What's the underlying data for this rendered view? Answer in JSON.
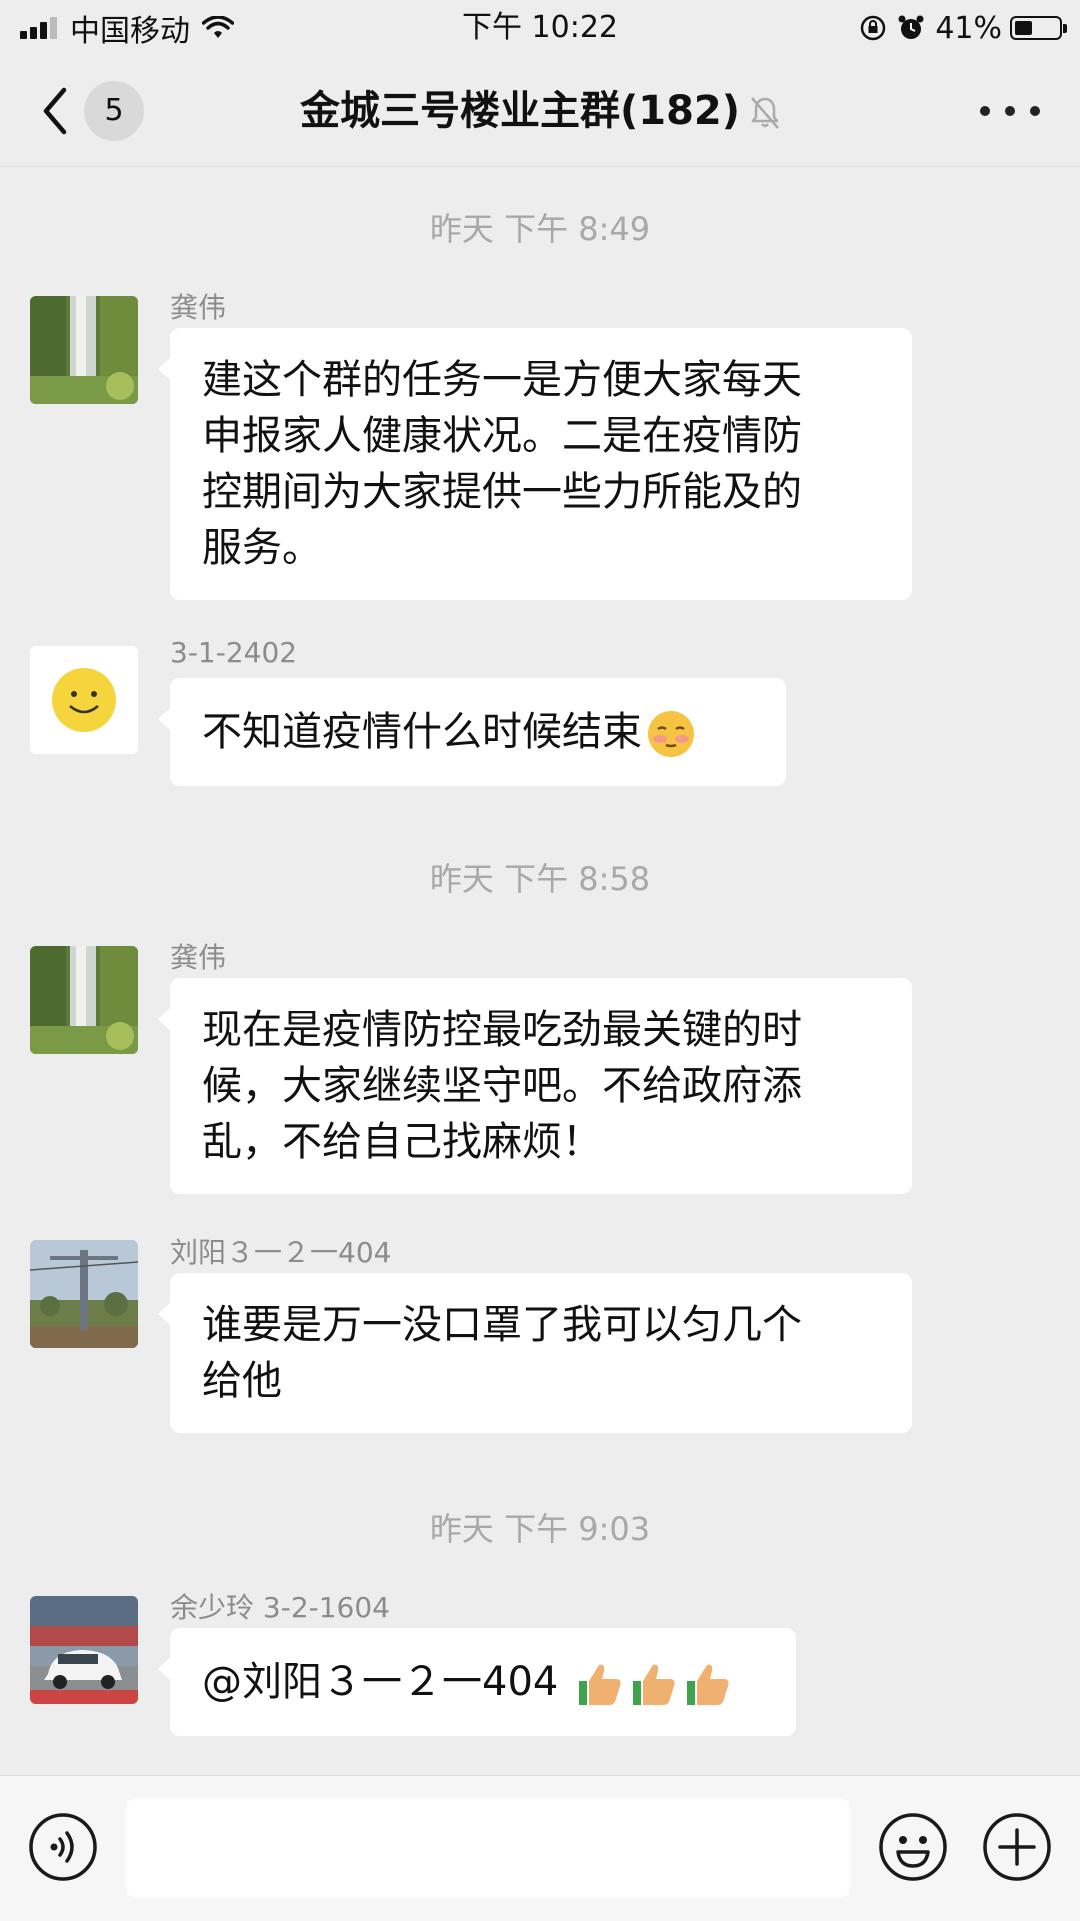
{
  "status_bar": {
    "carrier": "中国移动",
    "time": "下午 10:22",
    "battery": "41%",
    "battery_level": 0.41
  },
  "header": {
    "unread_count": "5",
    "title": "金城三号楼业主群(182)"
  },
  "messages": [
    {
      "type": "timestamp",
      "text": "昨天 下午 8:49"
    },
    {
      "type": "message",
      "sender": "龚伟",
      "avatar": "waterfall-photo",
      "lines": [
        "建这个群的任务一是方便大家每天",
        "申报家人健康状况。二是在疫情防",
        "控期间为大家提供一些力所能及的",
        "服务。"
      ]
    },
    {
      "type": "message",
      "sender": "3-1-2402",
      "avatar": "smiley-face",
      "text": "不知道疫情什么时候结束",
      "emoji": "flushed-face"
    },
    {
      "type": "timestamp",
      "text": "昨天 下午 8:58"
    },
    {
      "type": "message",
      "sender": "龚伟",
      "avatar": "waterfall-photo",
      "lines": [
        "现在是疫情防控最吃劲最关键的时",
        "候，大家继续坚守吧。不给政府添",
        "乱，不给自己找麻烦！"
      ]
    },
    {
      "type": "message",
      "sender": "刘阳３一２一404",
      "avatar": "cable-car-photo",
      "lines": [
        "谁要是万一没口罩了我可以匀几个",
        "给他"
      ]
    },
    {
      "type": "timestamp",
      "text": "昨天 下午 9:03"
    },
    {
      "type": "message",
      "sender": "余少玲 3-2-1604",
      "avatar": "white-car-photo",
      "text": "@刘阳３一２一404 ",
      "emoji": "thumbs-up x3"
    }
  ],
  "input_bar": {
    "placeholder": "",
    "icons": [
      "voice-icon",
      "emoji-icon",
      "plus-icon"
    ]
  },
  "colors": {
    "background": "#ededed",
    "bubble": "#ffffff",
    "timestamp": "#a8a8a8",
    "sender": "#8c8c8c"
  }
}
